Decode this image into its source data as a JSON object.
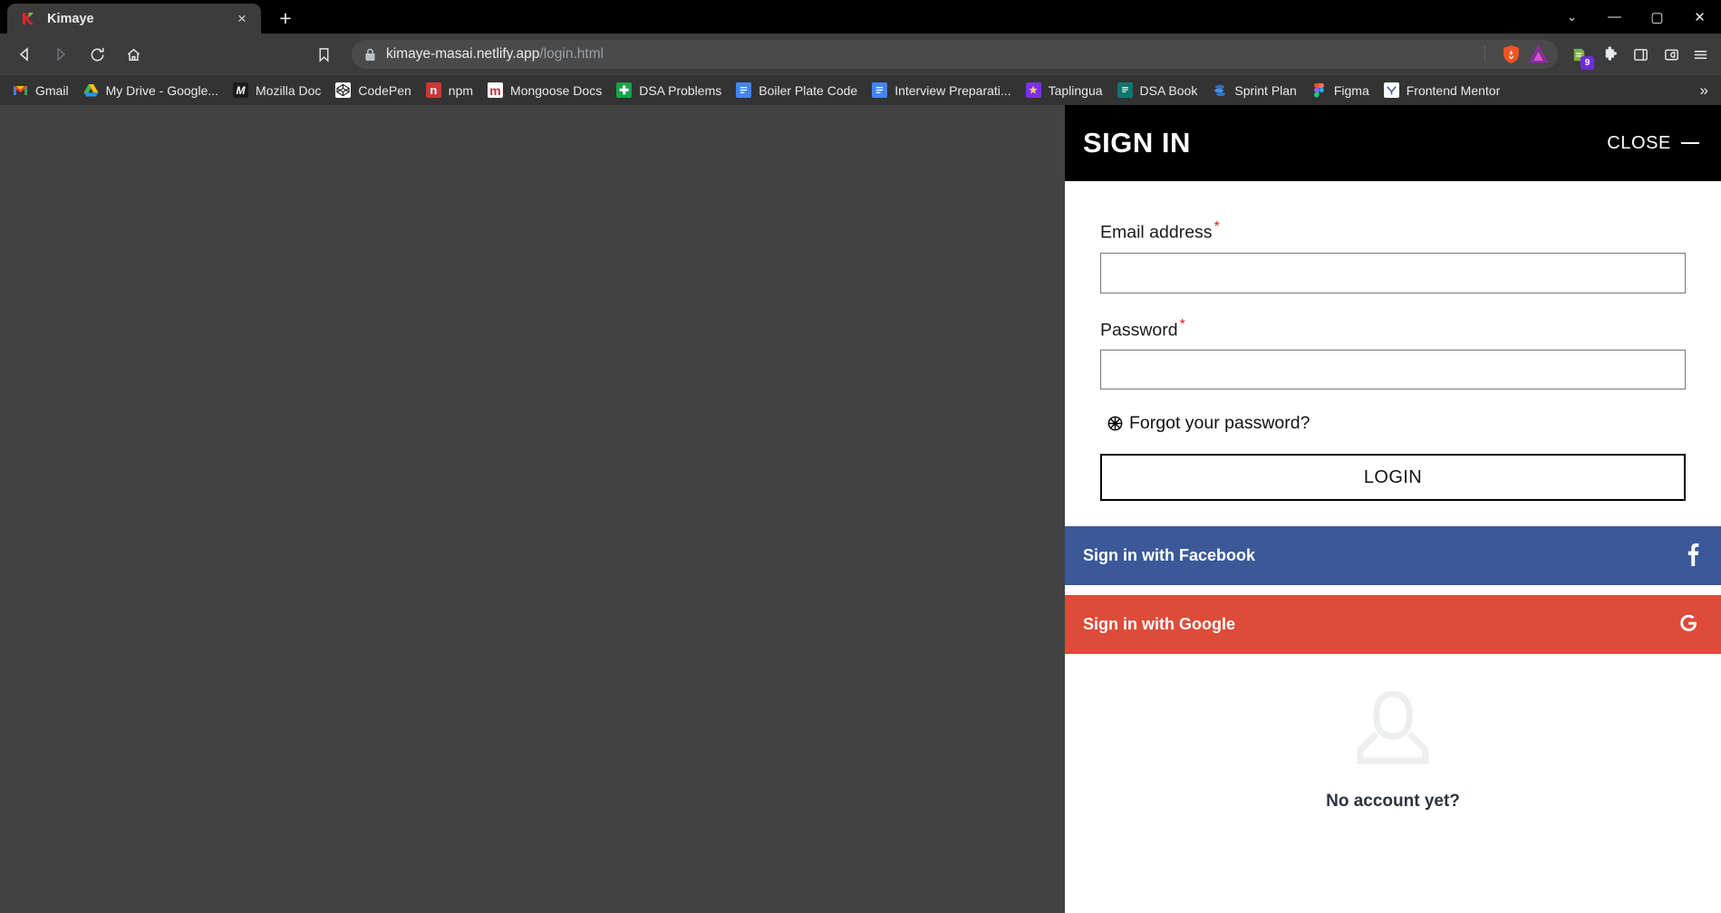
{
  "browser": {
    "tab": {
      "title": "Kimaye",
      "favicon": "kimaye-logo-icon",
      "close": "×"
    },
    "new_tab": "+",
    "window_controls": {
      "list": "⌄",
      "minimize": "—",
      "maximize": "▢",
      "close": "✕"
    },
    "nav": {
      "back": "◁",
      "forward": "▷",
      "reload": "⟳",
      "home": "⌂",
      "bookmark_star": "bookmark-icon"
    },
    "omnibox": {
      "lock": "lock-icon",
      "domain": "kimaye-masai.netlify.app",
      "path": "/login.html",
      "brave_shield": "brave-shields-icon",
      "brave_rewards": "brave-rewards-icon"
    },
    "toolbar_right": {
      "extension_badge": "9",
      "puzzle": "extensions-icon",
      "sidebar": "sidebar-icon",
      "wallet": "brave-wallet-icon",
      "menu": "hamburger-menu-icon"
    },
    "bookmarks": [
      {
        "label": "Gmail",
        "icon": "M",
        "fg": "#ea4335",
        "bg": "transparent"
      },
      {
        "label": "My Drive - Google...",
        "icon": "▲",
        "fg": "#0f9d58",
        "bg": "transparent"
      },
      {
        "label": "Mozilla Doc",
        "icon": "M",
        "fg": "#ffffff",
        "bg": "#1b1b1b"
      },
      {
        "label": "CodePen",
        "icon": "◈",
        "fg": "#111111",
        "bg": "#ffffff"
      },
      {
        "label": "npm",
        "icon": "n",
        "fg": "#ffffff",
        "bg": "#cb3837"
      },
      {
        "label": "Mongoose Docs",
        "icon": "m",
        "fg": "#b33",
        "bg": "#ffffff"
      },
      {
        "label": "DSA Problems",
        "icon": "✚",
        "fg": "#ffffff",
        "bg": "#16a34a"
      },
      {
        "label": "Boiler Plate Code",
        "icon": "▤",
        "fg": "#ffffff",
        "bg": "#4285f4"
      },
      {
        "label": "Interview Preparati...",
        "icon": "▤",
        "fg": "#ffffff",
        "bg": "#4285f4"
      },
      {
        "label": "Taplingua",
        "icon": "★",
        "fg": "#ffd24d",
        "bg": "#7b2ff2"
      },
      {
        "label": "DSA Book",
        "icon": "▤",
        "fg": "#ffffff",
        "bg": "#0f766e"
      },
      {
        "label": "Sprint Plan",
        "icon": "≔",
        "fg": "#ffffff",
        "bg": "#2d6fd0"
      },
      {
        "label": "Figma",
        "icon": "⬤",
        "fg": "#f24e1e",
        "bg": "transparent"
      },
      {
        "label": "Frontend Mentor",
        "icon": "↘",
        "fg": "#3f54a3",
        "bg": "#ffffff"
      }
    ],
    "bookmarks_overflow": "»"
  },
  "signin": {
    "title": "SIGN IN",
    "close_label": "CLOSE",
    "email": {
      "label": "Email address",
      "required_mark": "*",
      "value": "",
      "placeholder": ""
    },
    "password": {
      "label": "Password",
      "required_mark": "*",
      "value": "",
      "placeholder": ""
    },
    "forgot": {
      "icon": "✺",
      "text": "Forgot your password?"
    },
    "login_label": "LOGIN",
    "social": [
      {
        "label": "Sign in with Facebook",
        "icon": "f",
        "color": "#3b5998"
      },
      {
        "label": "Sign in with Google",
        "icon": "G",
        "color": "#dd4b39"
      }
    ],
    "no_account": {
      "avatar": "user-avatar-icon",
      "text": "No account yet?"
    }
  },
  "colors": {
    "chrome_dark": "#3c3c3c",
    "tabstrip": "#000000",
    "bookmarkbar": "#333333",
    "panel_header": "#000000",
    "facebook": "#3b5998",
    "google": "#dd4b39",
    "required": "#e02020",
    "page_backdrop": "#434343"
  }
}
